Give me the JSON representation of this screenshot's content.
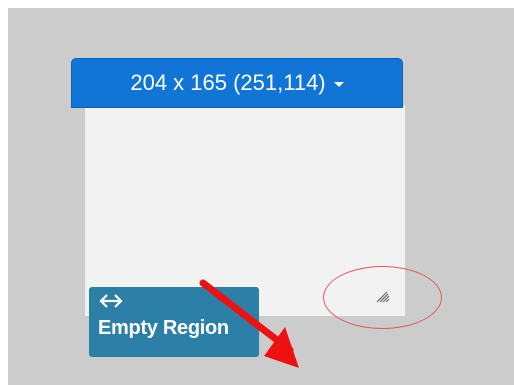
{
  "selection": {
    "size_label": "204 x 165 (251,114)",
    "dropdown_icon": "caret-down-icon"
  },
  "region_badge": {
    "icon": "horizontal-resize-arrows-icon",
    "label": "Empty Region"
  },
  "resize_grip": {
    "icon": "resize-grip-icon"
  },
  "annotations": {
    "circle_color": "#e35a5a",
    "arrow_color": "#ee1111"
  },
  "colors": {
    "background": "#cccccc",
    "panel": "#f2f2f2",
    "dropdown": "#1175d8",
    "badge": "#2c7fa7"
  }
}
